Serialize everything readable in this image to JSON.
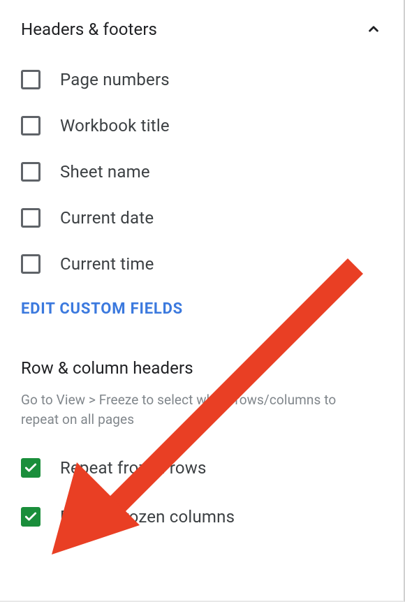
{
  "headers_footers": {
    "title": "Headers & footers",
    "expanded": true,
    "options": [
      {
        "label": "Page numbers",
        "checked": false
      },
      {
        "label": "Workbook title",
        "checked": false
      },
      {
        "label": "Sheet name",
        "checked": false
      },
      {
        "label": "Current date",
        "checked": false
      },
      {
        "label": "Current time",
        "checked": false
      }
    ],
    "edit_link": "EDIT CUSTOM FIELDS"
  },
  "row_col_headers": {
    "title": "Row & column headers",
    "hint": "Go to View > Freeze to select which rows/columns to repeat on all pages",
    "options": [
      {
        "label": "Repeat frozen rows",
        "checked": true
      },
      {
        "label": "Repeat frozen columns",
        "checked": true
      }
    ]
  },
  "annotation": {
    "type": "arrow",
    "color": "#e93f24",
    "target": "repeat-frozen-columns-checkbox"
  }
}
